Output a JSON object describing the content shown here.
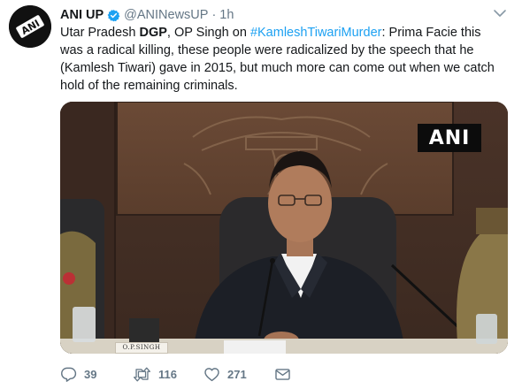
{
  "tweet": {
    "author_name": "ANI UP",
    "handle": "@ANINewsUP",
    "separator": "·",
    "time": "1h",
    "avatar_text": "ANI",
    "text_parts": {
      "p1": "Utar Pradesh ",
      "p2": "DGP",
      "p3": ", OP Singh on ",
      "hashtag": "#KamleshTiwariMurder",
      "p4": ": Prima Facie this was a radical killing, these people were radicalized by the speech that he (Kamlesh Tiwari) gave in 2015, but much more can come out when we catch hold of the remaining criminals."
    },
    "media": {
      "watermark": "ANI",
      "nameplate": "O.P.SINGH"
    },
    "actions": {
      "reply_count": "39",
      "retweet_count": "116",
      "like_count": "271"
    }
  },
  "colors": {
    "link": "#1da1f2",
    "muted": "#657786",
    "text": "#14171a",
    "verified": "#1da1f2"
  },
  "icons": {
    "verified": "verified-badge-icon",
    "caret": "chevron-down-icon",
    "reply": "reply-icon",
    "retweet": "retweet-icon",
    "like": "heart-icon",
    "dm": "envelope-icon"
  }
}
